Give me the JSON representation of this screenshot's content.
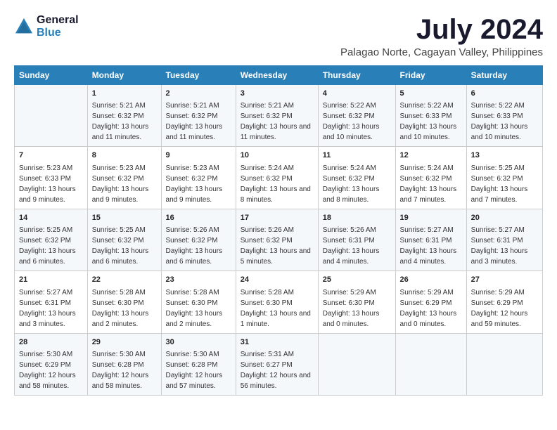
{
  "logo": {
    "line1": "General",
    "line2": "Blue"
  },
  "title": "July 2024",
  "subtitle": "Palagao Norte, Cagayan Valley, Philippines",
  "days": [
    "Sunday",
    "Monday",
    "Tuesday",
    "Wednesday",
    "Thursday",
    "Friday",
    "Saturday"
  ],
  "weeks": [
    [
      {
        "date": "",
        "sunrise": "",
        "sunset": "",
        "daylight": ""
      },
      {
        "date": "1",
        "sunrise": "Sunrise: 5:21 AM",
        "sunset": "Sunset: 6:32 PM",
        "daylight": "Daylight: 13 hours and 11 minutes."
      },
      {
        "date": "2",
        "sunrise": "Sunrise: 5:21 AM",
        "sunset": "Sunset: 6:32 PM",
        "daylight": "Daylight: 13 hours and 11 minutes."
      },
      {
        "date": "3",
        "sunrise": "Sunrise: 5:21 AM",
        "sunset": "Sunset: 6:32 PM",
        "daylight": "Daylight: 13 hours and 11 minutes."
      },
      {
        "date": "4",
        "sunrise": "Sunrise: 5:22 AM",
        "sunset": "Sunset: 6:32 PM",
        "daylight": "Daylight: 13 hours and 10 minutes."
      },
      {
        "date": "5",
        "sunrise": "Sunrise: 5:22 AM",
        "sunset": "Sunset: 6:33 PM",
        "daylight": "Daylight: 13 hours and 10 minutes."
      },
      {
        "date": "6",
        "sunrise": "Sunrise: 5:22 AM",
        "sunset": "Sunset: 6:33 PM",
        "daylight": "Daylight: 13 hours and 10 minutes."
      }
    ],
    [
      {
        "date": "7",
        "sunrise": "Sunrise: 5:23 AM",
        "sunset": "Sunset: 6:33 PM",
        "daylight": "Daylight: 13 hours and 9 minutes."
      },
      {
        "date": "8",
        "sunrise": "Sunrise: 5:23 AM",
        "sunset": "Sunset: 6:32 PM",
        "daylight": "Daylight: 13 hours and 9 minutes."
      },
      {
        "date": "9",
        "sunrise": "Sunrise: 5:23 AM",
        "sunset": "Sunset: 6:32 PM",
        "daylight": "Daylight: 13 hours and 9 minutes."
      },
      {
        "date": "10",
        "sunrise": "Sunrise: 5:24 AM",
        "sunset": "Sunset: 6:32 PM",
        "daylight": "Daylight: 13 hours and 8 minutes."
      },
      {
        "date": "11",
        "sunrise": "Sunrise: 5:24 AM",
        "sunset": "Sunset: 6:32 PM",
        "daylight": "Daylight: 13 hours and 8 minutes."
      },
      {
        "date": "12",
        "sunrise": "Sunrise: 5:24 AM",
        "sunset": "Sunset: 6:32 PM",
        "daylight": "Daylight: 13 hours and 7 minutes."
      },
      {
        "date": "13",
        "sunrise": "Sunrise: 5:25 AM",
        "sunset": "Sunset: 6:32 PM",
        "daylight": "Daylight: 13 hours and 7 minutes."
      }
    ],
    [
      {
        "date": "14",
        "sunrise": "Sunrise: 5:25 AM",
        "sunset": "Sunset: 6:32 PM",
        "daylight": "Daylight: 13 hours and 6 minutes."
      },
      {
        "date": "15",
        "sunrise": "Sunrise: 5:25 AM",
        "sunset": "Sunset: 6:32 PM",
        "daylight": "Daylight: 13 hours and 6 minutes."
      },
      {
        "date": "16",
        "sunrise": "Sunrise: 5:26 AM",
        "sunset": "Sunset: 6:32 PM",
        "daylight": "Daylight: 13 hours and 6 minutes."
      },
      {
        "date": "17",
        "sunrise": "Sunrise: 5:26 AM",
        "sunset": "Sunset: 6:32 PM",
        "daylight": "Daylight: 13 hours and 5 minutes."
      },
      {
        "date": "18",
        "sunrise": "Sunrise: 5:26 AM",
        "sunset": "Sunset: 6:31 PM",
        "daylight": "Daylight: 13 hours and 4 minutes."
      },
      {
        "date": "19",
        "sunrise": "Sunrise: 5:27 AM",
        "sunset": "Sunset: 6:31 PM",
        "daylight": "Daylight: 13 hours and 4 minutes."
      },
      {
        "date": "20",
        "sunrise": "Sunrise: 5:27 AM",
        "sunset": "Sunset: 6:31 PM",
        "daylight": "Daylight: 13 hours and 3 minutes."
      }
    ],
    [
      {
        "date": "21",
        "sunrise": "Sunrise: 5:27 AM",
        "sunset": "Sunset: 6:31 PM",
        "daylight": "Daylight: 13 hours and 3 minutes."
      },
      {
        "date": "22",
        "sunrise": "Sunrise: 5:28 AM",
        "sunset": "Sunset: 6:30 PM",
        "daylight": "Daylight: 13 hours and 2 minutes."
      },
      {
        "date": "23",
        "sunrise": "Sunrise: 5:28 AM",
        "sunset": "Sunset: 6:30 PM",
        "daylight": "Daylight: 13 hours and 2 minutes."
      },
      {
        "date": "24",
        "sunrise": "Sunrise: 5:28 AM",
        "sunset": "Sunset: 6:30 PM",
        "daylight": "Daylight: 13 hours and 1 minute."
      },
      {
        "date": "25",
        "sunrise": "Sunrise: 5:29 AM",
        "sunset": "Sunset: 6:30 PM",
        "daylight": "Daylight: 13 hours and 0 minutes."
      },
      {
        "date": "26",
        "sunrise": "Sunrise: 5:29 AM",
        "sunset": "Sunset: 6:29 PM",
        "daylight": "Daylight: 13 hours and 0 minutes."
      },
      {
        "date": "27",
        "sunrise": "Sunrise: 5:29 AM",
        "sunset": "Sunset: 6:29 PM",
        "daylight": "Daylight: 12 hours and 59 minutes."
      }
    ],
    [
      {
        "date": "28",
        "sunrise": "Sunrise: 5:30 AM",
        "sunset": "Sunset: 6:29 PM",
        "daylight": "Daylight: 12 hours and 58 minutes."
      },
      {
        "date": "29",
        "sunrise": "Sunrise: 5:30 AM",
        "sunset": "Sunset: 6:28 PM",
        "daylight": "Daylight: 12 hours and 58 minutes."
      },
      {
        "date": "30",
        "sunrise": "Sunrise: 5:30 AM",
        "sunset": "Sunset: 6:28 PM",
        "daylight": "Daylight: 12 hours and 57 minutes."
      },
      {
        "date": "31",
        "sunrise": "Sunrise: 5:31 AM",
        "sunset": "Sunset: 6:27 PM",
        "daylight": "Daylight: 12 hours and 56 minutes."
      },
      {
        "date": "",
        "sunrise": "",
        "sunset": "",
        "daylight": ""
      },
      {
        "date": "",
        "sunrise": "",
        "sunset": "",
        "daylight": ""
      },
      {
        "date": "",
        "sunrise": "",
        "sunset": "",
        "daylight": ""
      }
    ]
  ]
}
